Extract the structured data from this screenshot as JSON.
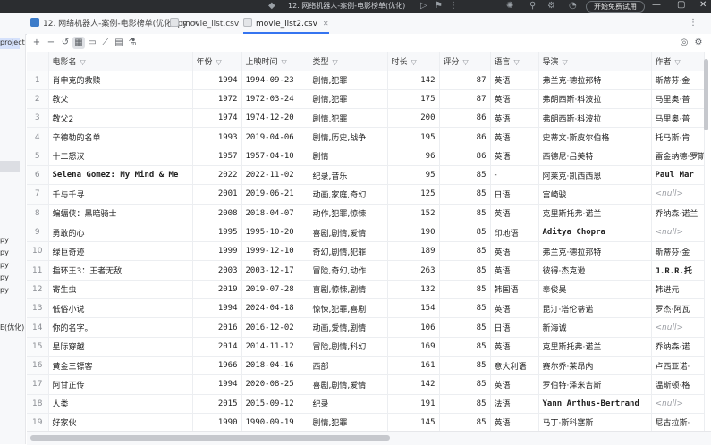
{
  "titlebar": {
    "title": "12. 网络机器人-案例-电影榜单(优化)",
    "pro_label": "开始免费试用",
    "minimize": "—",
    "maximize": "▢",
    "close": "✕"
  },
  "tabs": [
    {
      "label": "12. 网络机器人-案例-电影榜单(优化).py",
      "icon": "python-file-icon",
      "icon_color": "#3d7cc9",
      "active": false
    },
    {
      "label": "movie_list.csv",
      "icon": "csv-file-icon",
      "icon_color": "#8a8d93",
      "active": false
    },
    {
      "label": "movie_list2.csv",
      "icon": "csv-file-icon",
      "icon_color": "#8a8d93",
      "active": true
    }
  ],
  "sidebar": {
    "items": [
      "projectDT",
      "py",
      "py",
      "py",
      "py",
      "py",
      "E(优化).py"
    ]
  },
  "toolbar": {
    "add": "+",
    "remove": "−",
    "icons": [
      "table-view-icon",
      "text-view-icon",
      "chart-view-icon",
      "export-icon",
      "filter-icon"
    ],
    "eye": "◎",
    "settings": "⚙"
  },
  "table": {
    "columns": [
      "电影名",
      "年份",
      "上映时间",
      "类型",
      "时长",
      "评分",
      "语言",
      "导演",
      "作者"
    ],
    "rows": [
      [
        "1",
        "肖申克的救赎",
        "1994",
        "1994-09-23",
        "剧情,犯罪",
        "142",
        "87",
        "英语",
        "弗兰克·德拉邦特",
        "斯蒂芬·金"
      ],
      [
        "2",
        "教父",
        "1972",
        "1972-03-24",
        "剧情,犯罪",
        "175",
        "87",
        "英语",
        "弗朗西斯·科波拉",
        "马里奥·普"
      ],
      [
        "3",
        "教父2",
        "1974",
        "1974-12-20",
        "剧情,犯罪",
        "200",
        "86",
        "英语",
        "弗朗西斯·科波拉",
        "马里奥·普"
      ],
      [
        "4",
        "辛德勒的名单",
        "1993",
        "2019-04-06",
        "剧情,历史,战争",
        "195",
        "86",
        "英语",
        "史蒂文·斯皮尔伯格",
        "托马斯·肯"
      ],
      [
        "5",
        "十二怒汉",
        "1957",
        "1957-04-10",
        "剧情",
        "96",
        "86",
        "英语",
        "西德尼·吕美特",
        "雷金纳德·罗斯"
      ],
      [
        "6",
        "Selena Gomez: My Mind & Me",
        "2022",
        "2022-11-02",
        "纪录,音乐",
        "95",
        "85",
        "-",
        "阿莱克·凯西西恩",
        "Paul Mar"
      ],
      [
        "7",
        "千与千寻",
        "2001",
        "2019-06-21",
        "动画,家庭,奇幻",
        "125",
        "85",
        "日语",
        "宫崎骏",
        "<null>"
      ],
      [
        "8",
        "蝙蝠侠：黑暗骑士",
        "2008",
        "2018-04-07",
        "动作,犯罪,惊悚",
        "152",
        "85",
        "英语",
        "克里斯托弗·诺兰",
        "乔纳森·诺兰"
      ],
      [
        "9",
        "勇敢的心",
        "1995",
        "1995-10-20",
        "喜剧,剧情,爱情",
        "190",
        "85",
        "印地语",
        "Aditya Chopra",
        "<null>"
      ],
      [
        "10",
        "绿巨奇迹",
        "1999",
        "1999-12-10",
        "奇幻,剧情,犯罪",
        "189",
        "85",
        "英语",
        "弗兰克·德拉邦特",
        "斯蒂芬·金"
      ],
      [
        "11",
        "指环王3：王者无敌",
        "2003",
        "2003-12-17",
        "冒险,奇幻,动作",
        "263",
        "85",
        "英语",
        "彼得·杰克逊",
        "J.R.R.托"
      ],
      [
        "12",
        "寄生虫",
        "2019",
        "2019-07-28",
        "喜剧,惊悚,剧情",
        "132",
        "85",
        "韩国语",
        "奉俊昊",
        "韩进元"
      ],
      [
        "13",
        "低俗小说",
        "1994",
        "2024-04-18",
        "惊悚,犯罪,喜剧",
        "154",
        "85",
        "英语",
        "昆汀·塔伦蒂诺",
        "罗杰·阿瓦"
      ],
      [
        "14",
        "你的名字。",
        "2016",
        "2016-12-02",
        "动画,爱情,剧情",
        "106",
        "85",
        "日语",
        "新海诚",
        "<null>"
      ],
      [
        "15",
        "星际穿越",
        "2014",
        "2014-11-12",
        "冒险,剧情,科幻",
        "169",
        "85",
        "英语",
        "克里斯托弗·诺兰",
        "乔纳森·诺"
      ],
      [
        "16",
        "黄金三镖客",
        "1966",
        "2018-04-16",
        "西部",
        "161",
        "85",
        "意大利语",
        "赛尔乔·莱昂内",
        "卢西亚诺·"
      ],
      [
        "17",
        "阿甘正传",
        "1994",
        "2020-08-25",
        "喜剧,剧情,爱情",
        "142",
        "85",
        "英语",
        "罗伯特·泽米吉斯",
        "温斯顿·格"
      ],
      [
        "18",
        "人类",
        "2015",
        "2015-09-12",
        "纪录",
        "191",
        "85",
        "法语",
        "Yann Arthus-Bertrand",
        "<null>"
      ],
      [
        "19",
        "好家伙",
        "1990",
        "1990-09-19",
        "剧情,犯罪",
        "145",
        "85",
        "英语",
        "马丁·斯科塞斯",
        "尼古拉斯·"
      ]
    ]
  }
}
